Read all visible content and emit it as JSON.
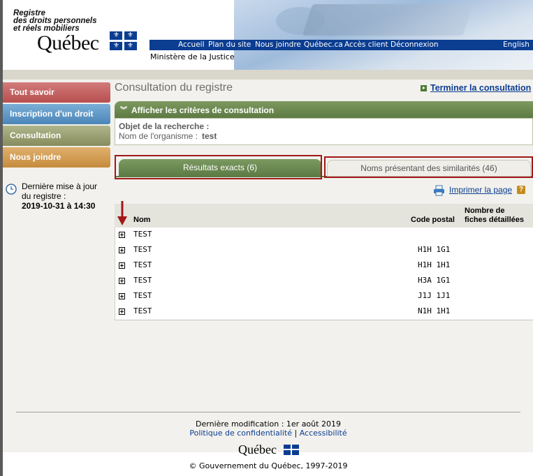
{
  "header": {
    "org_line1": "Registre",
    "org_line2": "des droits personnels",
    "org_line3": "et réels mobiliers",
    "logo": "Québec",
    "nav": [
      "Accueil",
      "Plan du site",
      "Nous joindre",
      "Québec.ca",
      "Accès client",
      "Déconnexion"
    ],
    "english": "English",
    "ministere": "Ministère de la Justice"
  },
  "sidebar": {
    "items": [
      {
        "label": "Tout savoir",
        "color": "#b84e4e"
      },
      {
        "label": "Inscription d'un droit",
        "color": "#4b86b8"
      },
      {
        "label": "Consultation",
        "color": "#868c5c"
      },
      {
        "label": "Nous joindre",
        "color": "#c58b3c"
      }
    ],
    "update_label": "Dernière mise à jour du registre :",
    "update_value": "2019-10-31 à 14:30"
  },
  "main": {
    "title": "Consultation du registre",
    "terminate_link": "Terminer la consultation",
    "criteria_toggle": "Afficher les critères de consultation",
    "criteria_object_label": "Objet de la recherche :",
    "criteria_name_label": "Nom de l'organisme :",
    "criteria_name_value": "test",
    "tabs": [
      {
        "label": "Résultats exacts (6)",
        "active": true
      },
      {
        "label": "Noms présentant des similarités (46)",
        "active": false
      }
    ],
    "print_link": "Imprimer la page",
    "help_icon": "?",
    "table": {
      "headers": {
        "nom": "Nom",
        "code_postal": "Code postal",
        "nombre_line1": "Nombre de",
        "nombre_line2": "fiches détaillées"
      },
      "rows": [
        {
          "nom": "TEST",
          "code_postal": ""
        },
        {
          "nom": "TEST",
          "code_postal": "H1H 1G1"
        },
        {
          "nom": "TEST",
          "code_postal": "H1H 1H1"
        },
        {
          "nom": "TEST",
          "code_postal": "H3A 1G1"
        },
        {
          "nom": "TEST",
          "code_postal": "J1J 1J1"
        },
        {
          "nom": "TEST",
          "code_postal": "N1H 1H1"
        }
      ]
    }
  },
  "footer": {
    "last_modified": "Dernière modification : 1er août 2019",
    "privacy": "Politique de confidentialité",
    "separator": "|",
    "accessibility": "Accessibilité",
    "logo": "Québec",
    "copyright": "© Gouvernement du Québec, 1997-2019"
  },
  "colors": {
    "brand_blue": "#0b3d91",
    "green": "#5d7b44",
    "highlight_red": "#a11818"
  }
}
